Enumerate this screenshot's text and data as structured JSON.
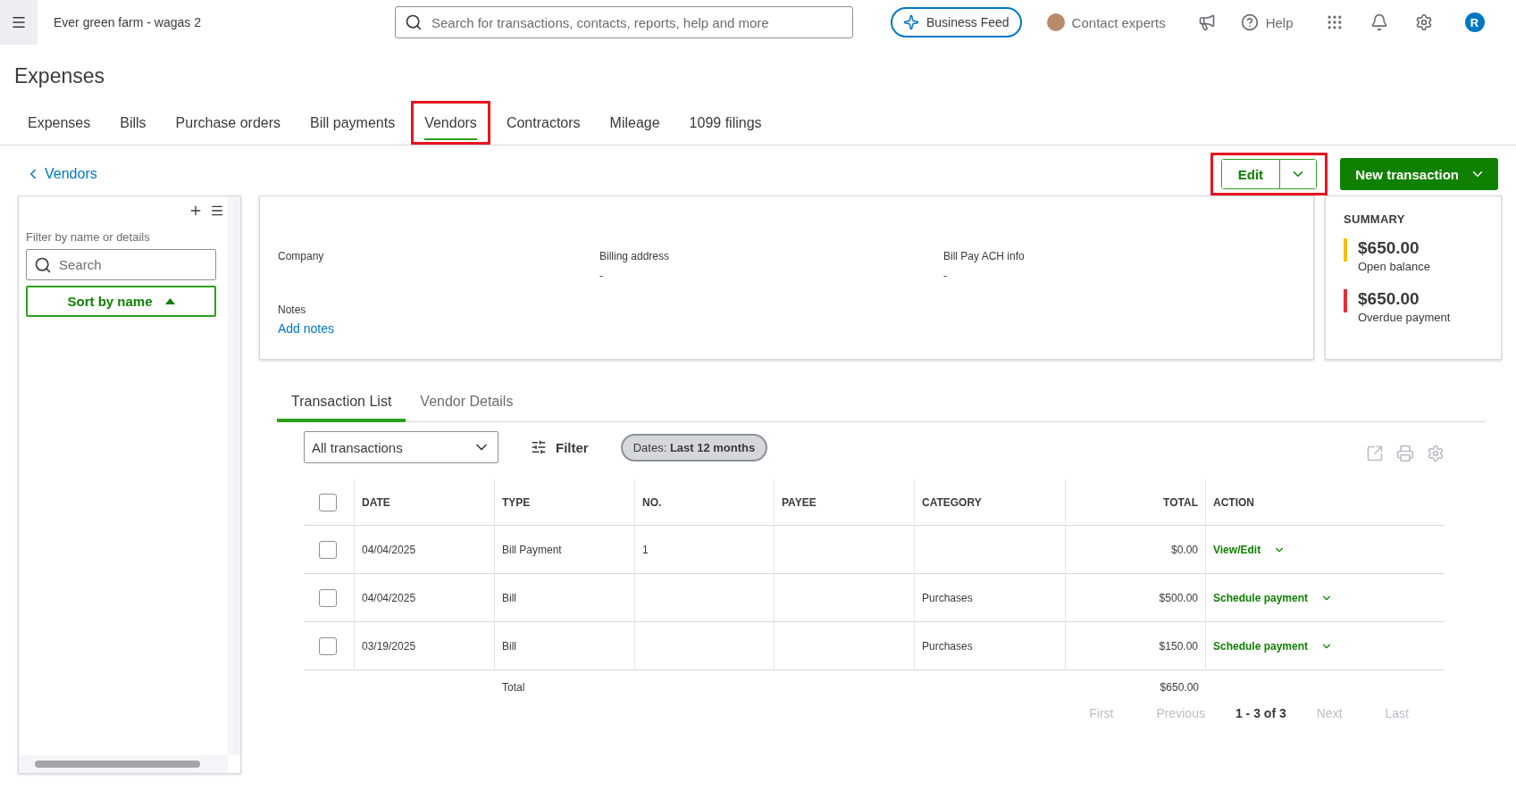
{
  "topbar": {
    "company": "Ever green farm - wagas 2",
    "search_placeholder": "Search for transactions, contacts, reports, help and more",
    "business_feed": "Business Feed",
    "contact_experts": "Contact experts",
    "help": "Help",
    "avatar": "R"
  },
  "page_title": "Expenses",
  "tabs": [
    {
      "label": "Expenses",
      "selected": false,
      "highlighted": false
    },
    {
      "label": "Bills",
      "selected": false,
      "highlighted": false
    },
    {
      "label": "Purchase orders",
      "selected": false,
      "highlighted": false
    },
    {
      "label": "Bill payments",
      "selected": false,
      "highlighted": false
    },
    {
      "label": "Vendors",
      "selected": true,
      "highlighted": true
    },
    {
      "label": "Contractors",
      "selected": false,
      "highlighted": false
    },
    {
      "label": "Mileage",
      "selected": false,
      "highlighted": false
    },
    {
      "label": "1099 filings",
      "selected": false,
      "highlighted": false
    }
  ],
  "back_link": "Vendors",
  "actions": {
    "edit": "Edit",
    "edit_highlighted": true,
    "new_transaction": "New transaction"
  },
  "vendor_list": {
    "filter_label": "Filter by name or details",
    "search_placeholder": "Search",
    "sort": "Sort by name"
  },
  "details": {
    "fields": [
      {
        "label": "Company"
      },
      {
        "label": "Billing address",
        "value": "-"
      },
      {
        "label": "Bill Pay ACH info",
        "value": "-"
      }
    ],
    "notes_label": "Notes",
    "add_notes": "Add notes"
  },
  "summary": {
    "title": "SUMMARY",
    "items": [
      {
        "amount": "$650.00",
        "label": "Open balance",
        "color": "#f5c000"
      },
      {
        "amount": "$650.00",
        "label": "Overdue payment",
        "color": "#e2303a"
      }
    ]
  },
  "detail_tabs": [
    {
      "label": "Transaction List",
      "selected": true
    },
    {
      "label": "Vendor Details",
      "selected": false
    }
  ],
  "toolbar": {
    "type_filter": "All transactions",
    "filter": "Filter",
    "dates": "Dates: **Last 12 months**"
  },
  "table": {
    "columns": [
      "DATE",
      "TYPE",
      "NO.",
      "PAYEE",
      "CATEGORY",
      "TOTAL",
      "ACTION"
    ],
    "all_checked": false,
    "rows": [
      {
        "checked": false,
        "date": "04/04/2025",
        "type": "Bill Payment",
        "no": "1",
        "total": "$0.00",
        "action": "View/Edit"
      },
      {
        "checked": false,
        "date": "04/04/2025",
        "type": "Bill",
        "category": "Purchases",
        "total": "$500.00",
        "action": "Schedule payment"
      },
      {
        "checked": false,
        "date": "03/19/2025",
        "type": "Bill",
        "category": "Purchases",
        "total": "$150.00",
        "action": "Schedule payment"
      }
    ],
    "total_label": "Total",
    "total": "$650.00"
  },
  "pagination": {
    "first": "First",
    "previous": "Previous",
    "range": "1 - 3 of 3",
    "next": "Next",
    "last": "Last"
  }
}
